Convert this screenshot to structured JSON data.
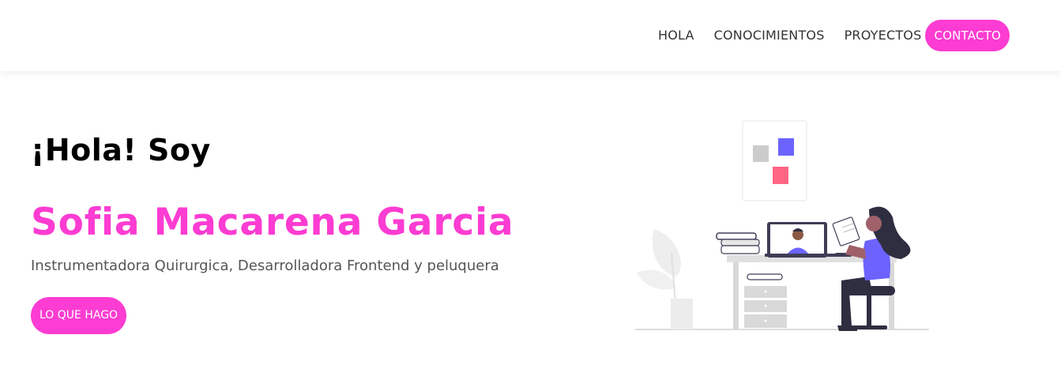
{
  "nav": {
    "links": [
      "HOLA",
      "CONOCIMIENTOS",
      "PROYECTOS"
    ],
    "contact_label": "CONTACTO"
  },
  "hero": {
    "greeting": "¡Hola! Soy",
    "name": "Sofia Macarena Garcia",
    "tagline": "Instrumentadora Quirurgica, Desarrolladora Frontend y peluquera",
    "cta_label": "LO QUE HAGO"
  },
  "colors": {
    "accent": "#fc3cd2",
    "illustration_purple": "#6c63ff",
    "illustration_pink": "#ff6584",
    "illustration_dark": "#2f2e41"
  }
}
